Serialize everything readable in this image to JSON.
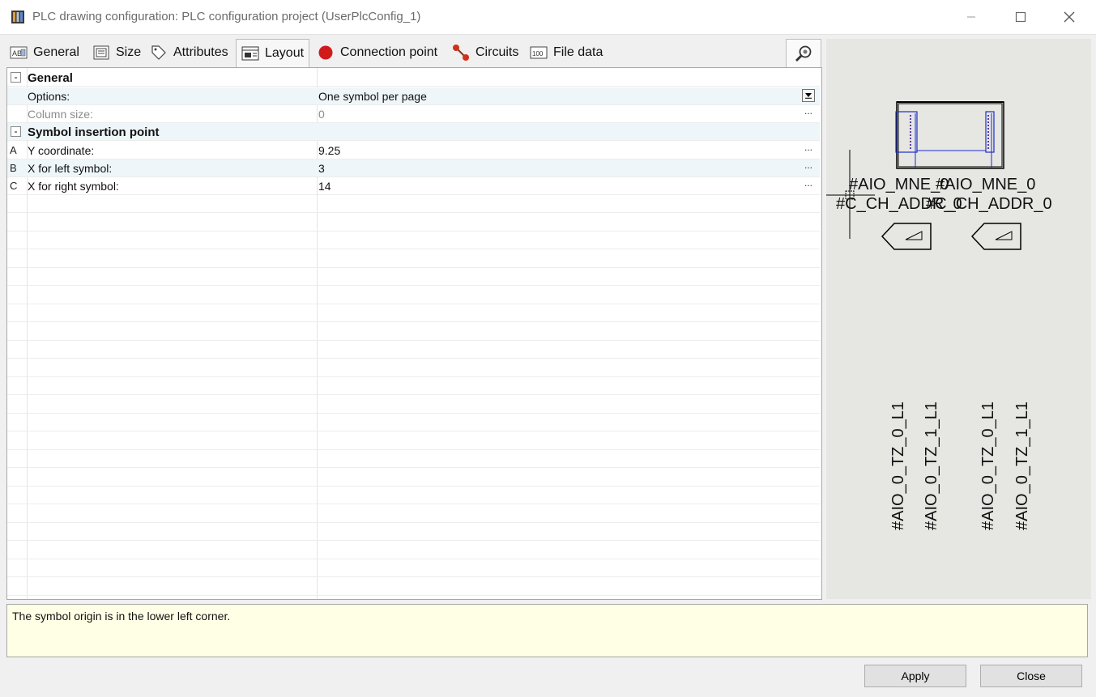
{
  "window": {
    "title": "PLC drawing configuration: PLC configuration project (UserPlcConfig_1)"
  },
  "tabs": [
    {
      "label": "General",
      "icon": "general-tab-icon"
    },
    {
      "label": "Size",
      "icon": "size-tab-icon"
    },
    {
      "label": "Attributes",
      "icon": "tag-icon"
    },
    {
      "label": "Layout",
      "icon": "layout-tab-icon",
      "active": true
    },
    {
      "label": "Connection point",
      "icon": "red-dot-icon"
    },
    {
      "label": "Circuits",
      "icon": "circuits-icon"
    },
    {
      "label": "File data",
      "icon": "file-data-icon"
    }
  ],
  "grid": {
    "sections": [
      {
        "title": "General",
        "collapse": "-",
        "rows": [
          {
            "letter": "",
            "label": "Options:",
            "value": "One symbol per page",
            "control": "dropdown",
            "enabled": true
          },
          {
            "letter": "",
            "label": "Column size:",
            "value": "0",
            "control": "ellipsis",
            "enabled": false
          }
        ]
      },
      {
        "title": "Symbol insertion point",
        "collapse": "-",
        "rows": [
          {
            "letter": "A",
            "label": "Y coordinate:",
            "value": "9.25",
            "control": "ellipsis",
            "enabled": true
          },
          {
            "letter": "B",
            "label": "X for left symbol:",
            "value": "3",
            "control": "ellipsis",
            "enabled": true
          },
          {
            "letter": "C",
            "label": "X for right symbol:",
            "value": "14",
            "control": "ellipsis",
            "enabled": true
          }
        ]
      }
    ],
    "ellipsis": "..."
  },
  "preview": {
    "texts": {
      "mne_left": "#AIO_MNE_0",
      "mne_right": "#AIO_MNE_0",
      "addr_left": "#C_CH_ADDR_0",
      "addr_right": "#C_CH_ADDR_0",
      "vert1": "#AIO_0_TZ_0_L1",
      "vert2": "#AIO_0_TZ_1_L1",
      "vert3": "#AIO_0_TZ_0_L1",
      "vert4": "#AIO_0_TZ_1_L1"
    }
  },
  "description": "The symbol origin is in the lower left corner.",
  "buttons": {
    "apply": "Apply",
    "close": "Close"
  },
  "colors": {
    "alt_row": "#eef6f9",
    "description_bg": "#ffffe6",
    "preview_bg": "#e6e6e3",
    "connection_point_red": "#d21a1a"
  }
}
